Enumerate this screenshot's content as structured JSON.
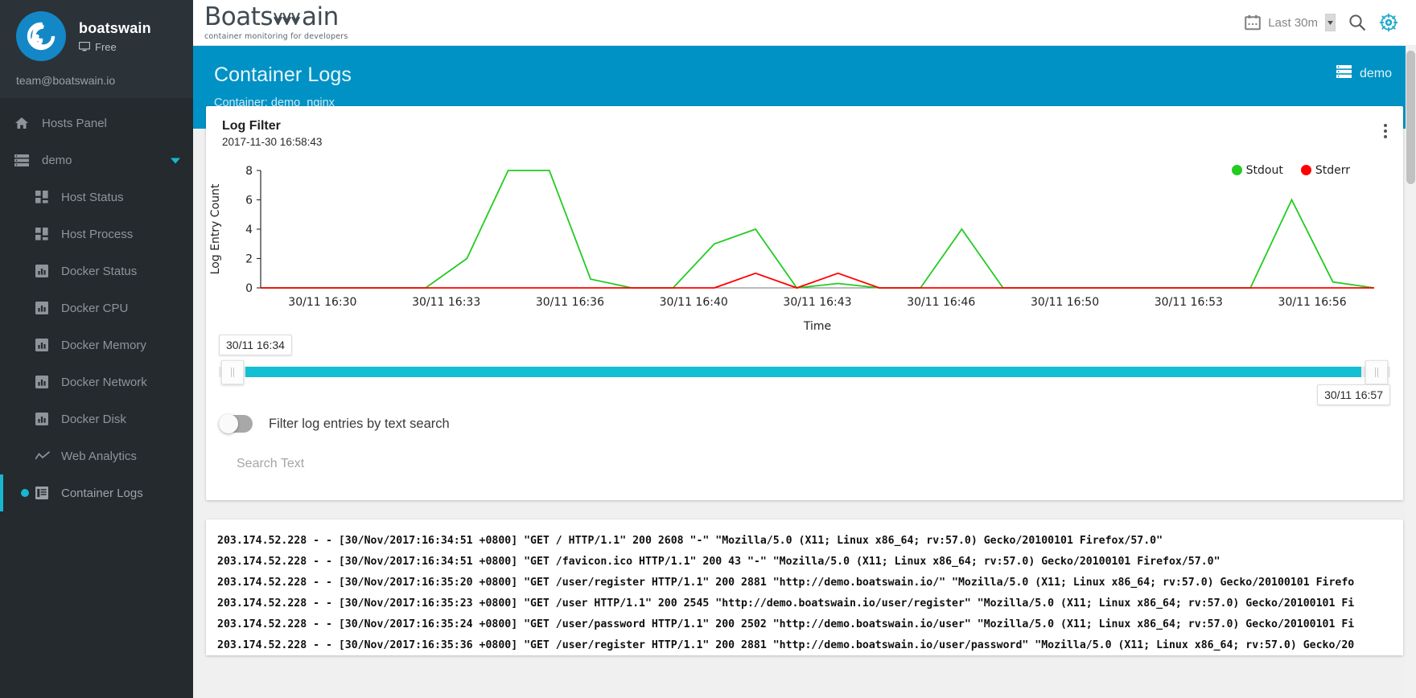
{
  "sidebar": {
    "user": "boatswain",
    "plan": "Free",
    "email": "team@boatswain.io",
    "items": [
      {
        "label": "Hosts Panel",
        "icon": "home-icon",
        "level": "top"
      },
      {
        "label": "demo",
        "icon": "server-icon",
        "level": "group"
      },
      {
        "label": "Host Status",
        "icon": "dashboard-icon",
        "level": "sub"
      },
      {
        "label": "Host Process",
        "icon": "dashboard-icon",
        "level": "sub"
      },
      {
        "label": "Docker Status",
        "icon": "bar-chart-icon",
        "level": "sub"
      },
      {
        "label": "Docker CPU",
        "icon": "bar-chart-icon",
        "level": "sub"
      },
      {
        "label": "Docker Memory",
        "icon": "bar-chart-icon",
        "level": "sub"
      },
      {
        "label": "Docker Network",
        "icon": "bar-chart-icon",
        "level": "sub"
      },
      {
        "label": "Docker Disk",
        "icon": "bar-chart-icon",
        "level": "sub"
      },
      {
        "label": "Web Analytics",
        "icon": "line-chart-icon",
        "level": "sub"
      },
      {
        "label": "Container Logs",
        "icon": "logs-icon",
        "level": "sub",
        "active": true
      }
    ]
  },
  "topbar": {
    "logo_text_left": "Boats",
    "logo_text_right": "ain",
    "logo_tagline": "container monitoring for developers",
    "time_range": "Last 30m",
    "calendar_icon": "calendar-icon",
    "search_icon": "search-icon",
    "helm_icon": "ship-wheel-icon"
  },
  "banner": {
    "title": "Container Logs",
    "subtitle": "Container: demo_nginx",
    "host_label": "demo",
    "host_icon": "server-icon",
    "color": "#0092c4"
  },
  "card": {
    "title": "Log Filter",
    "timestamp": "2017-11-30 16:58:43",
    "menu_icon": "kebab-menu-icon"
  },
  "slider": {
    "start_label": "30/11 16:34",
    "end_label": "30/11 16:57",
    "fill_color": "#14bed3"
  },
  "filter": {
    "toggle_label": "Filter log entries by text search",
    "toggle_state": "off",
    "search_placeholder": "Search Text",
    "search_value": ""
  },
  "logs": [
    "203.174.52.228 - - [30/Nov/2017:16:34:51 +0800] \"GET / HTTP/1.1\" 200 2608 \"-\" \"Mozilla/5.0 (X11; Linux x86_64; rv:57.0) Gecko/20100101 Firefox/57.0\"",
    "203.174.52.228 - - [30/Nov/2017:16:34:51 +0800] \"GET /favicon.ico HTTP/1.1\" 200 43 \"-\" \"Mozilla/5.0 (X11; Linux x86_64; rv:57.0) Gecko/20100101 Firefox/57.0\"",
    "203.174.52.228 - - [30/Nov/2017:16:35:20 +0800] \"GET /user/register HTTP/1.1\" 200 2881 \"http://demo.boatswain.io/\" \"Mozilla/5.0 (X11; Linux x86_64; rv:57.0) Gecko/20100101 Firefo",
    "203.174.52.228 - - [30/Nov/2017:16:35:23 +0800] \"GET /user HTTP/1.1\" 200 2545 \"http://demo.boatswain.io/user/register\" \"Mozilla/5.0 (X11; Linux x86_64; rv:57.0) Gecko/20100101 Fi",
    "203.174.52.228 - - [30/Nov/2017:16:35:24 +0800] \"GET /user/password HTTP/1.1\" 200 2502 \"http://demo.boatswain.io/user\" \"Mozilla/5.0 (X11; Linux x86_64; rv:57.0) Gecko/20100101 Fi",
    "203.174.52.228 - - [30/Nov/2017:16:35:36 +0800] \"GET /user/register HTTP/1.1\" 200 2881 \"http://demo.boatswain.io/user/password\" \"Mozilla/5.0 (X11; Linux x86_64; rv:57.0) Gecko/20"
  ],
  "chart_data": {
    "type": "line",
    "title": "",
    "xlabel": "Time",
    "ylabel": "Log Entry Count",
    "ylim": [
      0,
      8
    ],
    "yticks": [
      0,
      2,
      4,
      6,
      8
    ],
    "xticks": [
      "30/11 16:30",
      "30/11 16:33",
      "30/11 16:36",
      "30/11 16:40",
      "30/11 16:43",
      "30/11 16:46",
      "30/11 16:50",
      "30/11 16:53",
      "30/11 16:56"
    ],
    "legend": [
      "Stdout",
      "Stderr"
    ],
    "legend_position": "top-right",
    "grid": false,
    "colors": {
      "Stdout": "#22cc22",
      "Stderr": "#ff0000"
    },
    "x": [
      "16:30",
      "16:31",
      "16:32",
      "16:33",
      "16:34",
      "16:35",
      "16:36",
      "16:37",
      "16:38",
      "16:39",
      "16:40",
      "16:41",
      "16:42",
      "16:43",
      "16:44",
      "16:45",
      "16:46",
      "16:47",
      "16:48",
      "16:49",
      "16:50",
      "16:51",
      "16:52",
      "16:53",
      "16:54",
      "16:55",
      "16:56",
      "16:57"
    ],
    "series": [
      {
        "name": "Stdout",
        "color": "#22cc22",
        "values": [
          0,
          0,
          0,
          0,
          2,
          8,
          8,
          0.7,
          0,
          0,
          3,
          4,
          0,
          0.3,
          0,
          0,
          0,
          0,
          0,
          0,
          0,
          0,
          0,
          0,
          0,
          0,
          0,
          0
        ]
      },
      {
        "name": "Stderr",
        "color": "#ff0000",
        "values": [
          0,
          0,
          0,
          0,
          0,
          0,
          0,
          0,
          0,
          0,
          0,
          0,
          0,
          0,
          0,
          0,
          0,
          0,
          0,
          0,
          0,
          0,
          0,
          0,
          0,
          0,
          0,
          0
        ]
      }
    ],
    "stdout_points": [
      [
        0,
        0
      ],
      [
        4,
        0
      ],
      [
        5,
        2
      ],
      [
        6,
        8
      ],
      [
        7,
        8
      ],
      [
        8,
        0.6
      ],
      [
        9,
        0
      ],
      [
        10,
        0
      ],
      [
        11,
        3
      ],
      [
        12,
        4
      ],
      [
        13,
        0
      ],
      [
        14,
        0.3
      ],
      [
        15,
        0
      ],
      [
        16,
        0
      ],
      [
        17,
        4
      ],
      [
        18,
        0
      ],
      [
        19,
        0
      ],
      [
        24,
        0
      ],
      [
        25,
        6
      ],
      [
        26,
        0.4
      ],
      [
        27,
        0
      ]
    ],
    "stderr_points": [
      [
        0,
        0
      ],
      [
        11,
        0
      ],
      [
        12,
        1
      ],
      [
        13,
        0
      ],
      [
        14,
        1
      ],
      [
        15,
        0
      ],
      [
        27,
        0
      ]
    ]
  }
}
